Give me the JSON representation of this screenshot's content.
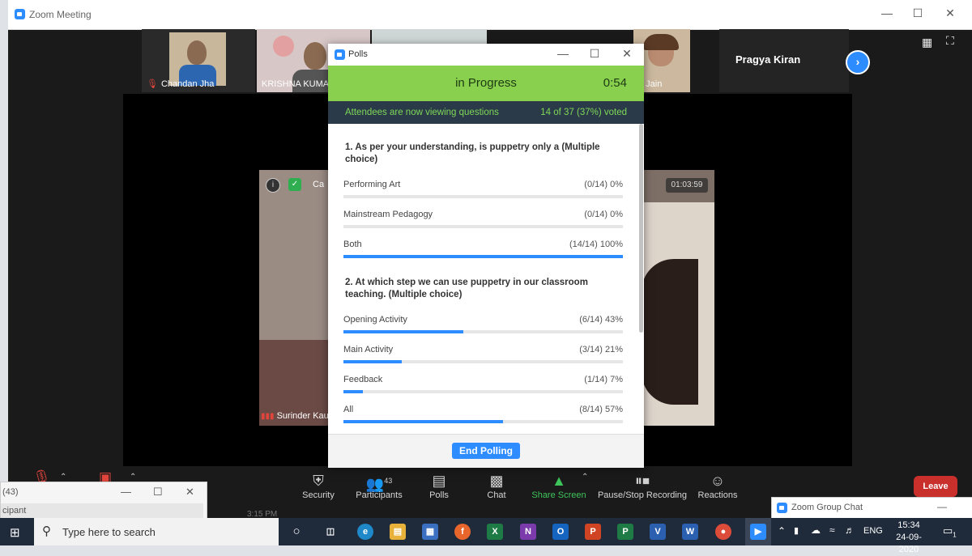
{
  "window": {
    "title": "Zoom Meeting"
  },
  "participants": [
    {
      "name": "Chandan Jha"
    },
    {
      "name": "KRISHNA KUMA"
    },
    {
      "name": "a Jain"
    }
  ],
  "active_speaker": {
    "name": "Pragya Kiran"
  },
  "main_video": {
    "name": "Surinder Kau",
    "label_partial": "Ca",
    "timer": "01:03:59"
  },
  "polls": {
    "title": "Polls",
    "status": "in Progress",
    "time": "0:54",
    "viewing_text": "Attendees are now viewing questions",
    "voted_text": "14 of 37 (37%) voted",
    "questions": [
      {
        "text": "1. As per your understanding, is puppetry only a (Multiple choice)",
        "options": [
          {
            "label": "Performing Art",
            "result": "(0/14) 0%",
            "fraction": 0.0
          },
          {
            "label": "Mainstream Pedagogy",
            "result": "(0/14) 0%",
            "fraction": 0.0
          },
          {
            "label": "Both",
            "result": "(14/14) 100%",
            "fraction": 1.0
          }
        ]
      },
      {
        "text": "2. At which step we can use puppetry in our classroom teaching. (Multiple choice)",
        "options": [
          {
            "label": "Opening Activity",
            "result": "(6/14) 43%",
            "fraction": 0.43
          },
          {
            "label": "Main Activity",
            "result": "(3/14) 21%",
            "fraction": 0.21
          },
          {
            "label": "Feedback",
            "result": "(1/14) 7%",
            "fraction": 0.07
          },
          {
            "label": "All",
            "result": "(8/14) 57%",
            "fraction": 0.57
          }
        ]
      }
    ],
    "end_button": "End Polling"
  },
  "controls": {
    "security": "Security",
    "participants": "Participants",
    "participants_count": "43",
    "polls": "Polls",
    "chat": "Chat",
    "share_screen": "Share Screen",
    "recording": "Pause/Stop Recording",
    "reactions": "Reactions",
    "leave": "Leave"
  },
  "left_window": {
    "count": "(43)",
    "text": "cipant",
    "time": "3:15 PM"
  },
  "chat_window": {
    "title": "Zoom Group Chat"
  },
  "taskbar": {
    "search_placeholder": "Type here to search",
    "language": "ENG",
    "time": "15:34",
    "date": "24-09-2020",
    "notification_count": "1"
  },
  "colors": {
    "poll_banner": "#8ad04f",
    "accent": "#2d8cff",
    "leave": "#c9302c"
  }
}
